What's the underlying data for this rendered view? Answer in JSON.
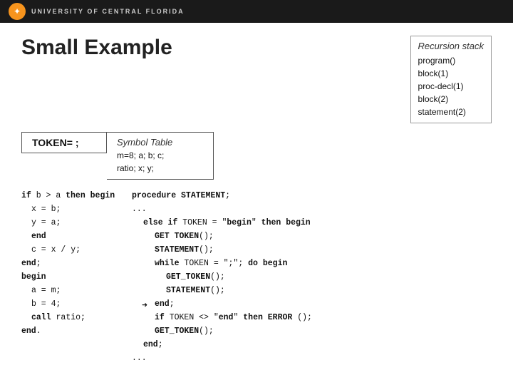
{
  "header": {
    "university_name": "UNIVERSITY OF CENTRAL FLORIDA"
  },
  "slide": {
    "title": "Small Example",
    "token_label": "TOKEN= ;",
    "symbol_table": {
      "title": "Symbol Table",
      "content": "m=8; a; b; c;\nratio; x; y;"
    },
    "recursion_stack": {
      "title": "Recursion stack",
      "items": [
        "program()",
        "block(1)",
        "proc-decl(1)",
        "block(2)",
        "statement(2)"
      ]
    },
    "left_code": [
      {
        "text": "if b > a then begin",
        "indent": 0
      },
      {
        "text": "x = b;",
        "indent": 1
      },
      {
        "text": "y = a;",
        "indent": 1
      },
      {
        "text": "end",
        "indent": 1
      },
      {
        "text": "c = x / y;",
        "indent": 1
      },
      {
        "text": "end;",
        "indent": 0
      },
      {
        "text": "begin",
        "indent": 0
      },
      {
        "text": "a = m;",
        "indent": 1
      },
      {
        "text": "b = 4;",
        "indent": 1
      },
      {
        "text": "call ratio;",
        "indent": 1
      },
      {
        "text": "end.",
        "indent": 0
      }
    ],
    "right_code": [
      {
        "text": "procedure STATEMENT;",
        "indent": 0,
        "arrow": false
      },
      {
        "text": "...",
        "indent": 0,
        "arrow": false
      },
      {
        "text": "else if TOKEN = \"begin\" then begin",
        "indent": 1,
        "arrow": false
      },
      {
        "text": "GET TOKEN();",
        "indent": 2,
        "arrow": false
      },
      {
        "text": "STATEMENT();",
        "indent": 2,
        "arrow": false
      },
      {
        "text": "while TOKEN = \";\"; do begin",
        "indent": 2,
        "arrow": false
      },
      {
        "text": "GET_TOKEN();",
        "indent": 3,
        "arrow": false
      },
      {
        "text": "STATEMENT();",
        "indent": 3,
        "arrow": false
      },
      {
        "text": "end;",
        "indent": 2,
        "arrow": true
      },
      {
        "text": "if TOKEN <> \"end\" then ERROR ();",
        "indent": 2,
        "arrow": false
      },
      {
        "text": "GET_TOKEN();",
        "indent": 2,
        "arrow": false
      },
      {
        "text": "end;",
        "indent": 1,
        "arrow": false
      },
      {
        "text": "...",
        "indent": 0,
        "arrow": false
      }
    ]
  }
}
